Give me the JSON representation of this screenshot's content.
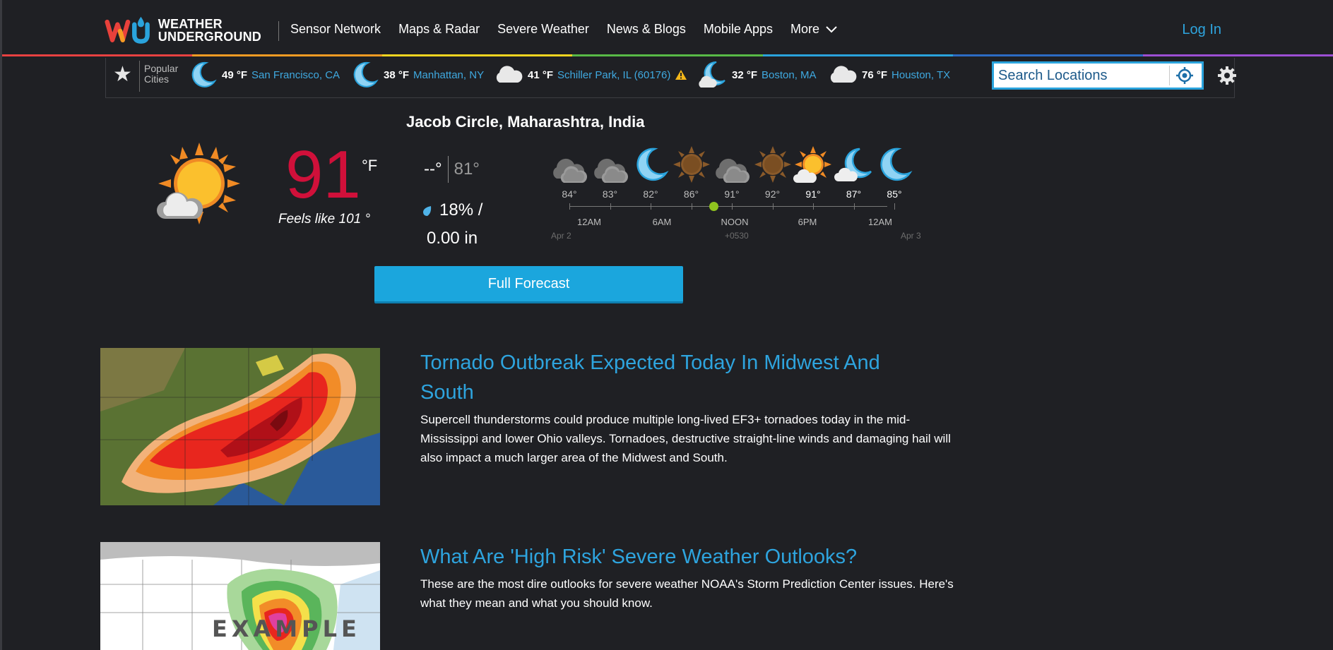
{
  "header": {
    "logo_text_line1": "WEATHER",
    "logo_text_line2": "UNDERGROUND",
    "nav": [
      "Sensor Network",
      "Maps & Radar",
      "Severe Weather",
      "News & Blogs",
      "Mobile Apps",
      "More"
    ],
    "login": "Log In",
    "rainbow_colors": [
      "#e84141",
      "#f59b23",
      "#f4d51f",
      "#58b947",
      "#2aa3dc",
      "#2c6cc4",
      "#9c4fd3"
    ]
  },
  "citybar": {
    "popular_line1": "Popular",
    "popular_line2": "Cities",
    "cities": [
      {
        "icon": "moon-icon",
        "temp": "49 °F",
        "name": "San Francisco, CA"
      },
      {
        "icon": "moon-icon",
        "temp": "38 °F",
        "name": "Manhattan, NY"
      },
      {
        "icon": "cloud-icon",
        "temp": "41 °F",
        "name": "Schiller Park, IL (60176)",
        "alert": true
      },
      {
        "icon": "moon-cloud-icon",
        "temp": "32 °F",
        "name": "Boston, MA"
      },
      {
        "icon": "cloud-icon",
        "temp": "76 °F",
        "name": "Houston, TX"
      }
    ],
    "search_placeholder": "Search Locations"
  },
  "current": {
    "location": "Jacob Circle, Maharashtra, India",
    "temp": "91",
    "unit": "°F",
    "feels_like": "Feels like 101 °",
    "high": "--°",
    "low": "81°",
    "precip_chance": "18% /",
    "precip_amount": "0.00 in",
    "temp_color": "#d0103a"
  },
  "hourly": {
    "temps": [
      "84°",
      "83°",
      "82°",
      "86°",
      "91°",
      "92°",
      "91°",
      "87°",
      "85°"
    ],
    "icons": [
      "clouds-icon",
      "clouds-icon",
      "moon-icon",
      "sun-icon",
      "clouds-icon",
      "sun-icon",
      "sun-cloud-icon",
      "moon-cloud-icon",
      "moon-icon"
    ],
    "labels": [
      "12AM",
      "6AM",
      "NOON",
      "6PM",
      "12AM"
    ],
    "date_start": "Apr 2",
    "timezone": "+0530",
    "date_end": "Apr 3"
  },
  "forecast_button": "Full Forecast",
  "articles": [
    {
      "title": "Tornado Outbreak Expected Today In Midwest And South",
      "desc": "Supercell thunderstorms could produce multiple long-lived EF3+ tornadoes today in the mid-Mississippi and lower Ohio valleys. Tornadoes, destructive straight-line winds and damaging hail will also impact a much larger area of the Midwest and South."
    },
    {
      "title": "What Are 'High Risk' Severe Weather Outlooks?",
      "desc": "These are the most dire outlooks for severe weather NOAA's Storm Prediction Center issues. Here's what they mean and what you should know.",
      "thumb_overlay": "EXAMPLE"
    }
  ]
}
